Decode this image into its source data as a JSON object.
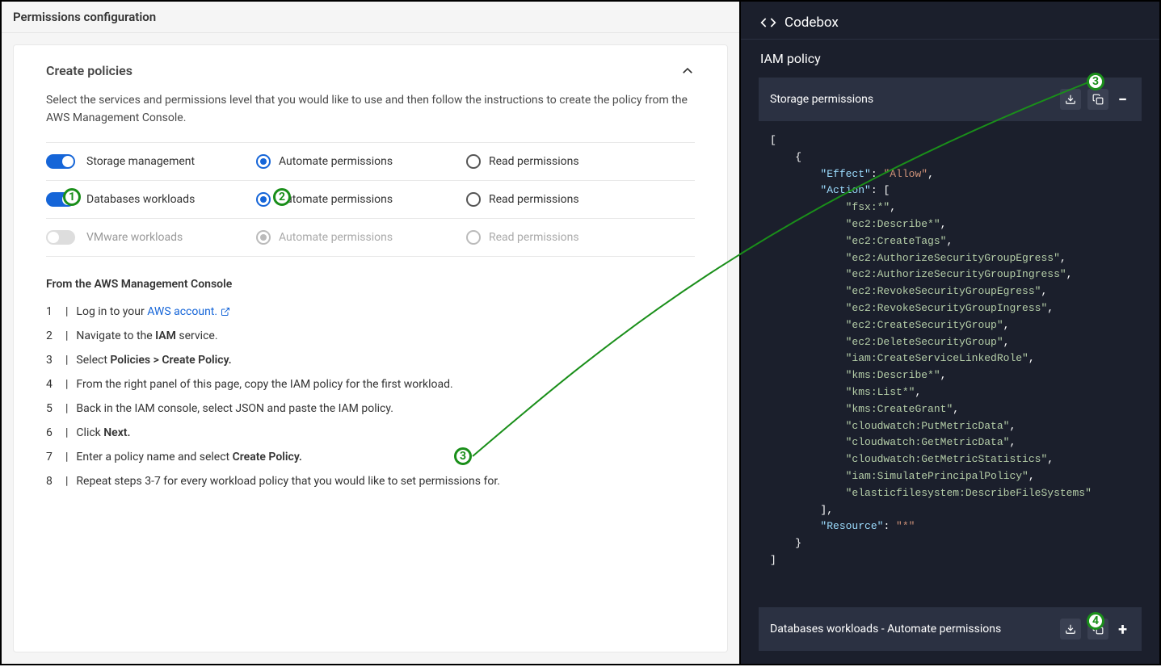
{
  "left_header": "Permissions configuration",
  "create_policies": {
    "title": "Create policies",
    "description": "Select the services and permissions level that you would like to use and then follow the instructions to create the policy from the AWS Management Console."
  },
  "services": [
    {
      "name": "Storage management",
      "enabled": true,
      "automate_label": "Automate permissions",
      "automate_selected": true,
      "read_label": "Read permissions",
      "read_selected": false
    },
    {
      "name": "Databases workloads",
      "enabled": true,
      "automate_label": "Automate permissions",
      "automate_selected": true,
      "read_label": "Read permissions",
      "read_selected": false
    },
    {
      "name": "VMware workloads",
      "enabled": false,
      "automate_label": "Automate permissions",
      "automate_selected": true,
      "read_label": "Read permissions",
      "read_selected": false
    }
  ],
  "instructions": {
    "heading": "From the AWS Management Console",
    "steps": {
      "s1a": "Log in to your ",
      "s1link": "AWS account.",
      "s2a": "Navigate to the ",
      "s2b": "IAM",
      "s2c": " service.",
      "s3a": "Select ",
      "s3b": "Policies > Create Policy.",
      "s4": "From the right panel of this page, copy the IAM policy for the first workload.",
      "s5": "Back in the IAM console, select JSON and paste the IAM policy.",
      "s6a": "Click ",
      "s6b": "Next.",
      "s7a": "Enter a policy name and select ",
      "s7b": "Create Policy.",
      "s8": "Repeat steps 3-7 for every workload policy that you would like to set permissions for."
    }
  },
  "codebox": {
    "title": "Codebox",
    "subtitle": "IAM policy",
    "block1_title": "Storage permissions",
    "block2_title": "Databases workloads - Automate permissions",
    "json": {
      "effect_key": "\"Effect\"",
      "effect_val": "\"Allow\"",
      "action_key": "\"Action\"",
      "actions": [
        "\"fsx:*\"",
        "\"ec2:Describe*\"",
        "\"ec2:CreateTags\"",
        "\"ec2:AuthorizeSecurityGroupEgress\"",
        "\"ec2:AuthorizeSecurityGroupIngress\"",
        "\"ec2:RevokeSecurityGroupEgress\"",
        "\"ec2:RevokeSecurityGroupIngress\"",
        "\"ec2:CreateSecurityGroup\"",
        "\"ec2:DeleteSecurityGroup\"",
        "\"iam:CreateServiceLinkedRole\"",
        "\"kms:Describe*\"",
        "\"kms:List*\"",
        "\"kms:CreateGrant\"",
        "\"cloudwatch:PutMetricData\"",
        "\"cloudwatch:GetMetricData\"",
        "\"cloudwatch:GetMetricStatistics\"",
        "\"iam:SimulatePrincipalPolicy\"",
        "\"elasticfilesystem:DescribeFileSystems\""
      ],
      "resource_key": "\"Resource\"",
      "resource_val": "\"*\""
    }
  },
  "callouts": {
    "c1": "1",
    "c2": "2",
    "c3": "3",
    "c3b": "3",
    "c4": "4"
  }
}
